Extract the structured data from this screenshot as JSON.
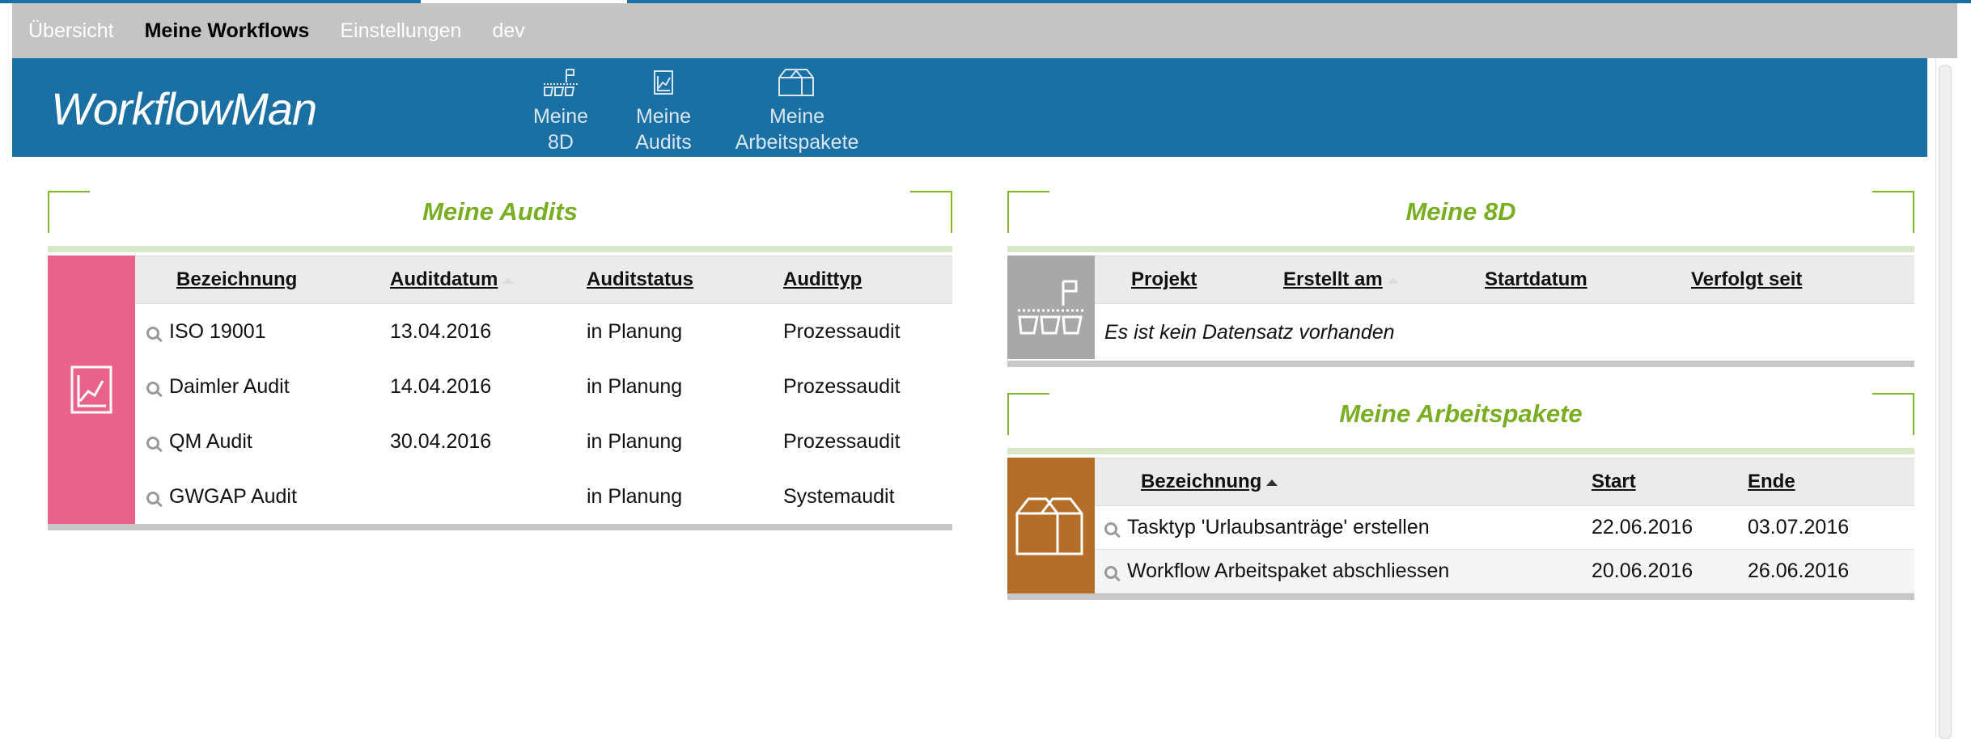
{
  "topnav": {
    "items": [
      {
        "label": "Übersicht",
        "active": false
      },
      {
        "label": "Meine Workflows",
        "active": true
      },
      {
        "label": "Einstellungen",
        "active": false
      },
      {
        "label": "dev",
        "active": false
      }
    ]
  },
  "header": {
    "brand": "WorkflowMan",
    "nav": [
      {
        "line1": "Meine",
        "line2": "8D",
        "icon": "flag-8d-icon"
      },
      {
        "line1": "Meine",
        "line2": "Audits",
        "icon": "audit-chart-icon"
      },
      {
        "line1": "Meine",
        "line2": "Arbeitspakete",
        "icon": "work-package-icon"
      }
    ]
  },
  "audits": {
    "title": "Meine Audits",
    "accent_color": "#e8628c",
    "columns": [
      "Bezeichnung",
      "Auditdatum",
      "Auditstatus",
      "Audittyp"
    ],
    "rows": [
      {
        "name": "ISO 19001",
        "date": "13.04.2016",
        "status": "in Planung",
        "type": "Prozessaudit"
      },
      {
        "name": "Daimler Audit",
        "date": "14.04.2016",
        "status": "in Planung",
        "type": "Prozessaudit"
      },
      {
        "name": "QM Audit",
        "date": "30.04.2016",
        "status": "in Planung",
        "type": "Prozessaudit"
      },
      {
        "name": "GWGAP Audit",
        "date": "",
        "status": "in Planung",
        "type": "Systemaudit"
      }
    ]
  },
  "eightd": {
    "title": "Meine 8D",
    "accent_color": "#a8a8a8",
    "columns": [
      "Projekt",
      "Erstellt am",
      "Startdatum",
      "Verfolgt seit"
    ],
    "empty_text": "Es ist kein Datensatz vorhanden"
  },
  "workpackages": {
    "title": "Meine Arbeitspakete",
    "accent_color": "#b36e2a",
    "columns": [
      "Bezeichnung",
      "Start",
      "Ende"
    ],
    "rows": [
      {
        "name": "Tasktyp 'Urlaubsanträge' erstellen",
        "start": "22.06.2016",
        "end": "03.07.2016"
      },
      {
        "name": "Workflow Arbeitspaket abschliessen",
        "start": "20.06.2016",
        "end": "26.06.2016"
      }
    ]
  }
}
